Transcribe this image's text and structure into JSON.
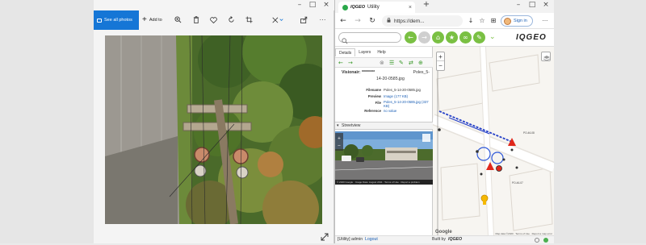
{
  "photos": {
    "see_all_label": "See all photos",
    "add_to_label": "Add to",
    "toolbar_icons": [
      "zoom-icon",
      "delete-icon",
      "favorite-icon",
      "rotate-icon",
      "crop-icon",
      "edit-icon",
      "share-icon",
      "more-icon"
    ],
    "more_label": "···"
  },
  "edge": {
    "tab_title": "Utility",
    "tab_brand": "IQGEO",
    "url": "https://dem...",
    "signin_label": "Sign in",
    "more_label": "···"
  },
  "app": {
    "logo": "IQGEO",
    "tabs": [
      {
        "label": "Details"
      },
      {
        "label": "Layers"
      },
      {
        "label": "Help"
      }
    ],
    "details": {
      "title_left": "Visionair: ********",
      "title_right": "Poles_5-",
      "title_line2": "14-20-0585.jpg",
      "rows": [
        {
          "key": "Filename",
          "value": "Poles_5-14-20-0585.jpg",
          "link": false
        },
        {
          "key": "Preview",
          "value": "Image (177 KB)",
          "link": true
        },
        {
          "key": "File",
          "value": "Poles_5-14-20-0585.jpg (337 KB)",
          "link": true
        },
        {
          "key": "Reference",
          "value": "no value",
          "link": true
        }
      ]
    },
    "streetview_label": "Streetview",
    "streetview_footer": "© 2020 Google · Image Date: August 2011 · Terms of Use · Report a problem",
    "status_user": "[Utility] admin",
    "status_logout": "Logout",
    "status_built_by": "Built by",
    "map_footer": "Map data ©2020 · Terms of Use · Report a map error",
    "google_label": "Google",
    "map_labels": [
      "PO-46-08",
      "PO-46-07"
    ]
  },
  "colors": {
    "accent_blue": "#1576d6",
    "app_green": "#7ac043",
    "link_blue": "#1b5fb5",
    "marker_red": "#e0281c"
  }
}
